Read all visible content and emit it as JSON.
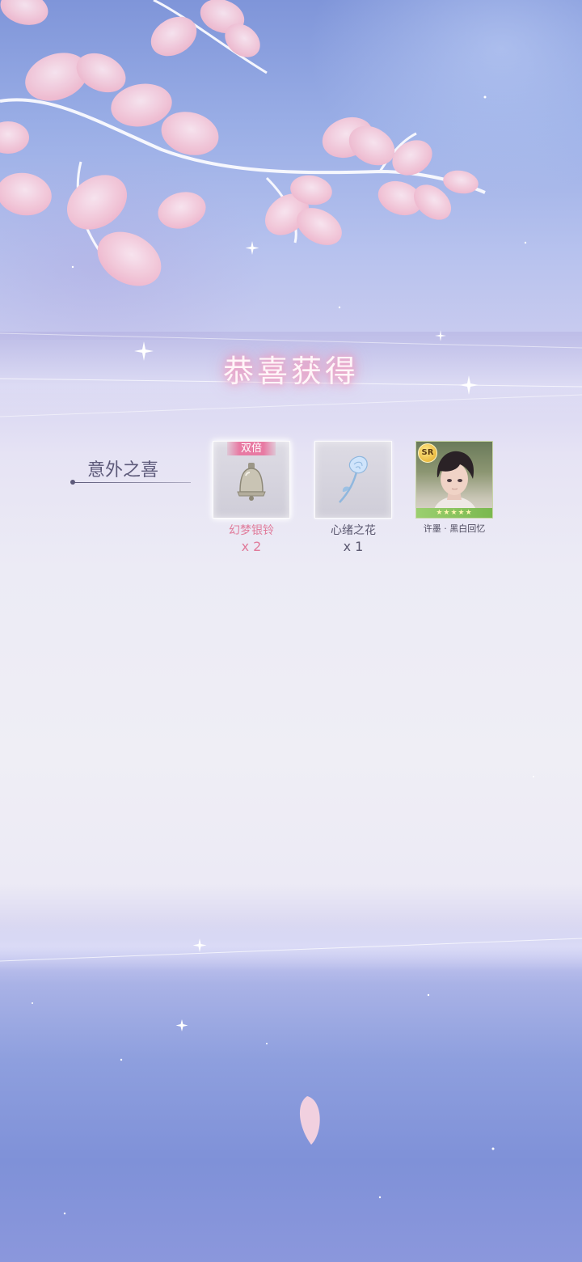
{
  "title": "恭喜获得",
  "section_label": "意外之喜",
  "rewards": [
    {
      "badge": "双倍",
      "name": "幻梦银铃",
      "quantity": "x 2",
      "icon": "silver-bell-icon"
    },
    {
      "name": "心绪之花",
      "quantity": "x 1",
      "icon": "blue-rose-icon"
    },
    {
      "rarity": "SR",
      "name": "许墨 · 黑白回忆",
      "stars": "★★★★★",
      "icon": "character-portrait"
    }
  ],
  "colors": {
    "title_glow": "#e98fb8",
    "double_badge": "#e87aa3",
    "double_text": "#e07a9a"
  }
}
